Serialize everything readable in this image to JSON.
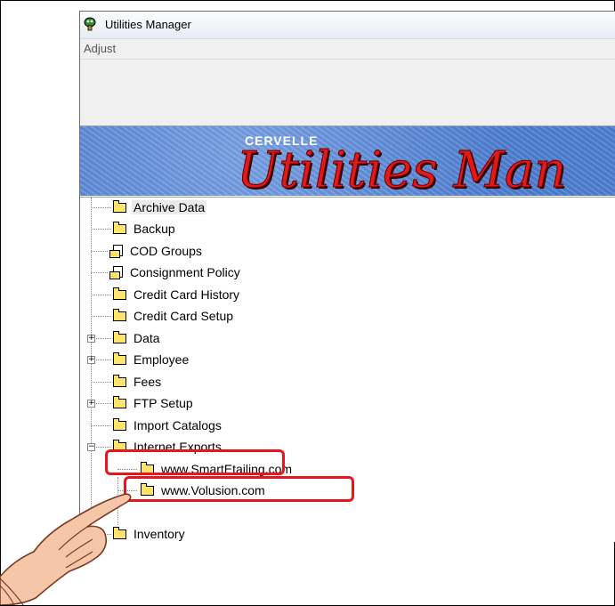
{
  "window": {
    "title": "Utilities Manager"
  },
  "menu": {
    "items": [
      "Adjust"
    ]
  },
  "banner": {
    "brand": "CERVELLE",
    "title": "Utilities Man"
  },
  "tree": {
    "items": [
      {
        "label": "Archive Data",
        "icon": "folder-icon"
      },
      {
        "label": "Backup",
        "icon": "folder-icon"
      },
      {
        "label": "COD Groups",
        "icon": "report-icon"
      },
      {
        "label": "Consignment Policy",
        "icon": "report-icon"
      },
      {
        "label": "Credit Card History",
        "icon": "folder-icon"
      },
      {
        "label": "Credit Card Setup",
        "icon": "folder-icon"
      },
      {
        "label": "Data",
        "icon": "folder-icon"
      },
      {
        "label": "Employee",
        "icon": "folder-icon"
      },
      {
        "label": "Fees",
        "icon": "folder-icon"
      },
      {
        "label": "FTP Setup",
        "icon": "folder-icon"
      },
      {
        "label": "Import Catalogs",
        "icon": "folder-icon"
      },
      {
        "label": "Internet Exports",
        "icon": "folder-icon"
      },
      {
        "label": "www.SmartEtailing.com",
        "icon": "folder-icon"
      },
      {
        "label": "www.Volusion.com",
        "icon": "folder-icon"
      },
      {
        "label": "Inventory",
        "icon": "folder-icon"
      }
    ]
  },
  "colors": {
    "highlight": "#e8141e",
    "banner": "#5b8be0",
    "banner_title": "#e31818"
  }
}
